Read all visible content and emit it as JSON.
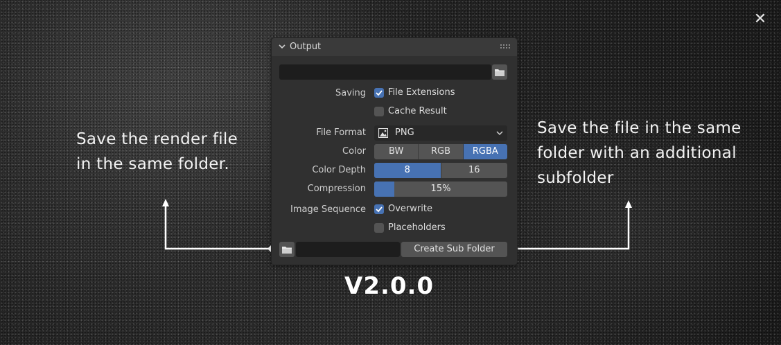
{
  "panel": {
    "title": "Output",
    "output_path": "",
    "saving_label": "Saving",
    "file_extensions": {
      "label": "File Extensions",
      "checked": true
    },
    "cache_result": {
      "label": "Cache Result",
      "checked": false
    },
    "file_format_label": "File Format",
    "file_format_value": "PNG",
    "color_label": "Color",
    "color_options": [
      "BW",
      "RGB",
      "RGBA"
    ],
    "color_selected": "RGBA",
    "color_depth_label": "Color Depth",
    "color_depth_options": [
      "8",
      "16"
    ],
    "color_depth_selected": "8",
    "compression_label": "Compression",
    "compression_value": "15%",
    "compression_fraction": 0.15,
    "image_sequence_label": "Image Sequence",
    "overwrite": {
      "label": "Overwrite",
      "checked": true
    },
    "placeholders": {
      "label": "Placeholders",
      "checked": false
    },
    "sub_folder_path": "",
    "create_sub_folder_label": "Create Sub Folder"
  },
  "captions": {
    "left": "Save the render file in the same folder.",
    "right": "Save the file in the same folder with an additional subfolder"
  },
  "version": "V2.0.0",
  "colors": {
    "accent": "#4772b3",
    "panel_bg": "#303030",
    "button_bg": "#545454",
    "field_bg": "#1d1d1d"
  },
  "icons": [
    "close-icon",
    "chevron-down-icon",
    "grip-icon",
    "folder-icon",
    "image-icon",
    "checkmark-icon"
  ]
}
